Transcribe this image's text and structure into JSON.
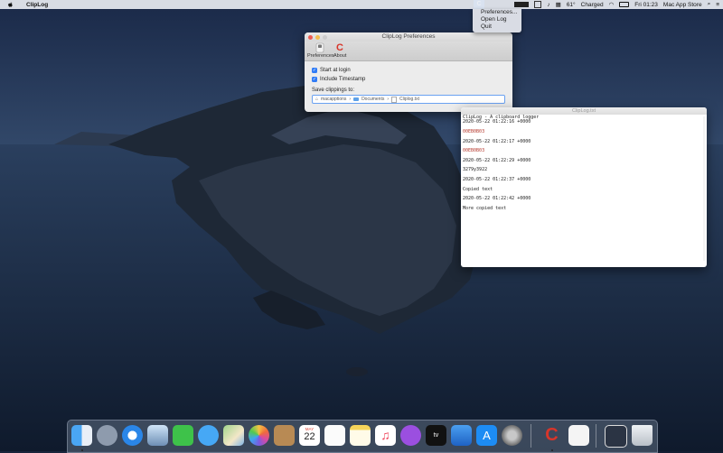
{
  "menubar": {
    "app_name": "ClipLog",
    "clock": "Fri 01:23",
    "store": "Mac App Store",
    "battery_text": "Charged",
    "temp": "61°",
    "status_item_letter": "C"
  },
  "status_menu": {
    "items": [
      "Preferences...",
      "Open Log",
      "Quit"
    ]
  },
  "prefs_window": {
    "title": "ClipLog Preferences",
    "tabs": [
      {
        "label": "Preferences",
        "icon": "switch-icon"
      },
      {
        "label": "About",
        "icon": "cliplog-logo-icon"
      }
    ],
    "logo_letter": "C",
    "start_at_login": "Start at login",
    "include_timestamp": "Include Timestamp",
    "save_label": "Save clippings to:",
    "path": [
      "macapptions",
      "Documents",
      "Cliplog.txt"
    ]
  },
  "log_window": {
    "title": "ClipLog.txt",
    "header": "ClipLog - A clipboard logger",
    "entries": [
      {
        "ts": "2020-05-22 01:22:16 +0000",
        "text": "00EB0B03"
      },
      {
        "ts": "2020-05-22 01:22:17 +0000",
        "text": "00EB0B03"
      },
      {
        "ts": "2020-05-22 01:22:29 +0000",
        "text": "3279y3922"
      },
      {
        "ts": "2020-05-22 01:22:37 +0000",
        "text": "Copied text"
      },
      {
        "ts": "2020-05-22 01:22:42 +0000",
        "text": "More copied text"
      }
    ]
  },
  "dock": {
    "calendar_month": "MAY",
    "calendar_day": "22",
    "clip_letter": "C",
    "apps": [
      "Finder",
      "Launchpad",
      "Safari",
      "Preview",
      "FaceTime",
      "Messages",
      "Maps",
      "Photos",
      "Contacts",
      "Calendar",
      "Reminders",
      "Notes",
      "Music",
      "Podcasts",
      "TV",
      "Keynote",
      "App Store",
      "System Preferences",
      "ClipLog",
      "TextEdit",
      "Screenshot",
      "Trash"
    ]
  }
}
